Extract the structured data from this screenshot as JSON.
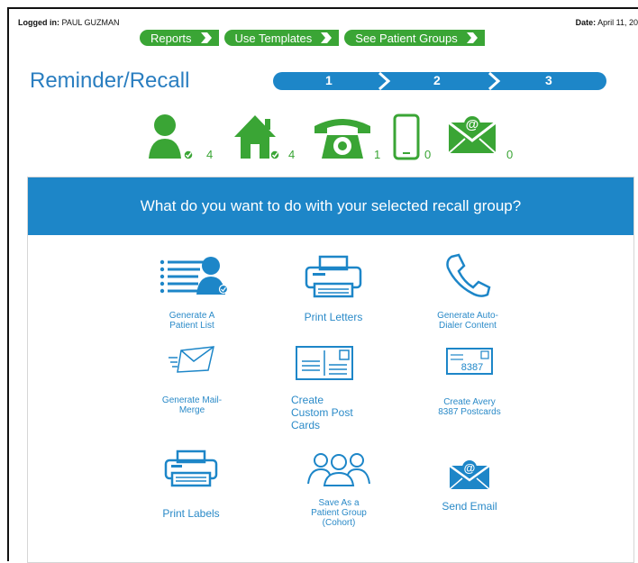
{
  "header": {
    "logged_in_label": "Logged in:",
    "user": "PAUL GUZMAN",
    "date_label": "Date:",
    "date_value": "April 11, 20"
  },
  "nav": {
    "reports": "Reports",
    "use_templates": "Use Templates",
    "see_patient_groups": "See Patient Groups"
  },
  "page": {
    "title": "Reminder/Recall",
    "steps": [
      "1",
      "2",
      "3"
    ]
  },
  "contact_methods": [
    {
      "icon": "person-icon",
      "count": "4"
    },
    {
      "icon": "home-icon",
      "count": "4"
    },
    {
      "icon": "phone-icon",
      "count": "1"
    },
    {
      "icon": "mobile-icon",
      "count": "0"
    },
    {
      "icon": "email-icon",
      "count": "0"
    }
  ],
  "panel": {
    "question": "What do you want to do with your selected recall group?",
    "options": {
      "patient_list": "Generate A\nPatient List",
      "print_letters": "Print Letters",
      "autodialer": "Generate Auto-\nDialer Content",
      "mail_merge": "Generate Mail-\nMerge",
      "custom_post": "Create\nCustom Post\nCards",
      "avery": "Create Avery\n8387 Postcards",
      "print_labels": "Print Labels",
      "save_group": "Save As a\nPatient Group\n(Cohort)",
      "send_email": "Send Email"
    },
    "avery_number": "8387"
  },
  "colors": {
    "green": "#3aa535",
    "blue": "#1d86c8",
    "title_blue": "#2a7ec0"
  }
}
